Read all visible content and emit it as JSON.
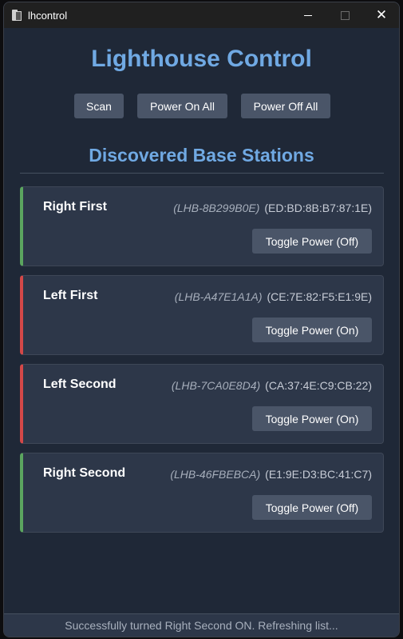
{
  "window": {
    "title": "lhcontrol",
    "close_glyph": "✕"
  },
  "header": {
    "title": "Lighthouse Control",
    "buttons": {
      "scan": "Scan",
      "power_on_all": "Power On All",
      "power_off_all": "Power Off All"
    }
  },
  "section": {
    "title": "Discovered Base Stations"
  },
  "stations": [
    {
      "name": "Right First",
      "id": "(LHB-8B299B0E)",
      "mac": "(ED:BD:8B:B7:87:1E)",
      "button": "Toggle Power (Off)",
      "status_color": "#5ba55f"
    },
    {
      "name": "Left First",
      "id": "(LHB-A47E1A1A)",
      "mac": "(CE:7E:82:F5:E1:9E)",
      "button": "Toggle Power (On)",
      "status_color": "#d34848"
    },
    {
      "name": "Left Second",
      "id": "(LHB-7CA0E8D4)",
      "mac": "(CA:37:4E:C9:CB:22)",
      "button": "Toggle Power (On)",
      "status_color": "#d34848"
    },
    {
      "name": "Right Second",
      "id": "(LHB-46FBEBCA)",
      "mac": "(E1:9E:D3:BC:41:C7)",
      "button": "Toggle Power (Off)",
      "status_color": "#5ba55f"
    }
  ],
  "status": {
    "message": "Successfully turned Right Second ON. Refreshing list..."
  },
  "colors": {
    "accent": "#70a9e3",
    "background": "#1f2837",
    "card": "#2d3749",
    "button": "#4a5568",
    "on": "#5ba55f",
    "off": "#d34848"
  },
  "icons": [
    "app-icon",
    "minimize-icon",
    "maximize-icon",
    "close-icon"
  ]
}
